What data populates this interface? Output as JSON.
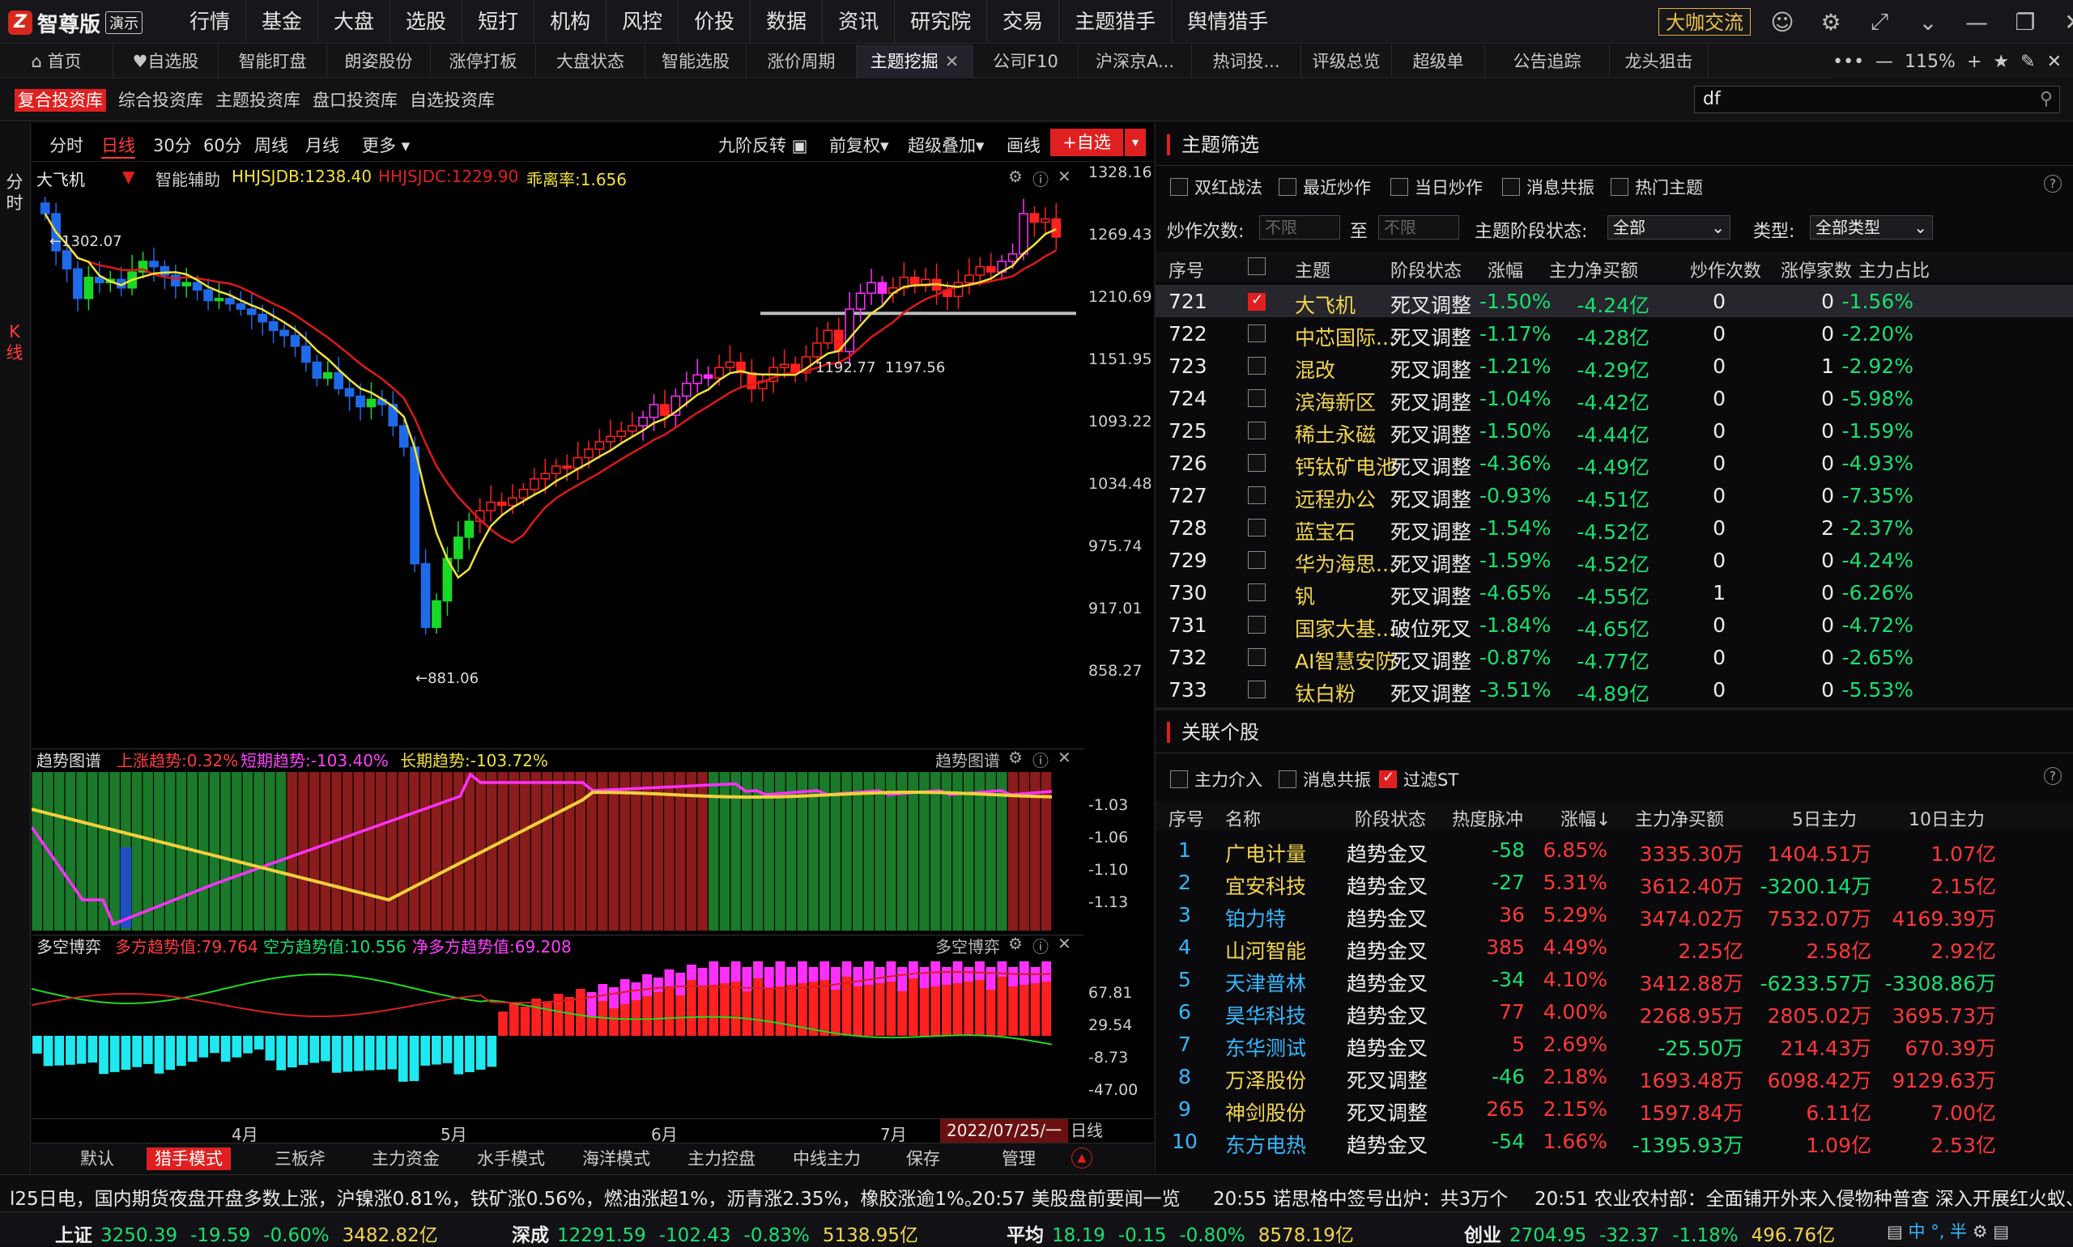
{
  "app": {
    "logo_mark": "Z",
    "title": "智尊版",
    "badge": "演示"
  },
  "top_menu": [
    "行情",
    "基金",
    "大盘",
    "选股",
    "短打",
    "机构",
    "风控",
    "价投",
    "数据",
    "资讯",
    "研究院",
    "交易",
    "主题猎手",
    "舆情猎手"
  ],
  "dakai": "大咖交流",
  "tabs": [
    "首页",
    "自选股",
    "智能盯盘",
    "朗姿股份",
    "涨停打板",
    "大盘状态",
    "智能选股",
    "涨价周期",
    "主题挖掘",
    "公司F10",
    "沪深京A...",
    "热词投...",
    "评级总览",
    "超级单",
    "公告追踪",
    "龙头狙击"
  ],
  "active_tab": "主题挖掘",
  "zoom": "115%",
  "sub_tabs": [
    "复合投资库",
    "综合投资库",
    "主题投资库",
    "盘口投资库",
    "自选投资库"
  ],
  "search_value": "df",
  "left_strip": {
    "top": "分时",
    "bottom": "K线"
  },
  "periods": [
    "分时",
    "日线",
    "30分",
    "60分",
    "周线",
    "月线",
    "更多"
  ],
  "active_period": "日线",
  "chart_toolbar": {
    "jiujie": "九阶反转",
    "fuquan": "前复权",
    "diejia": "超级叠加",
    "huaxian": "画线",
    "add": "+自选"
  },
  "indicator_main": {
    "name": "大飞机",
    "assist": "智能辅助",
    "hhjsjdb": "HHJSJDB:1238.40",
    "hhjsjdc": "HHJSJDC:1229.90",
    "guaili": "乖离率:1.656"
  },
  "indicator_trend": {
    "name": "趋势图谱",
    "up": "上涨趋势:0.32%",
    "short": "短期趋势:-103.40%",
    "long": "长期趋势:-103.72%"
  },
  "indicator_duokong": {
    "name": "多空博弈",
    "duo": "多方趋势值:79.764",
    "kong": "空方趋势值:10.556",
    "jing": "净多方趋势值:69.208"
  },
  "price_labels": {
    "high": "1302.07",
    "low": "881.06",
    "mid1": "1192.77",
    "mid2": "1197.56"
  },
  "chart_data": [
    {
      "type": "candlestick",
      "title": "大飞机",
      "yaxis_ticks": [
        "1328.16",
        "1269.43",
        "1210.69",
        "1151.95",
        "1093.22",
        "1034.48",
        "975.74",
        "917.01",
        "858.27"
      ],
      "xaxis_ticks": [
        "4月",
        "5月",
        "6月",
        "7月"
      ],
      "cursor_date": "2022/07/25/一",
      "period": "日线",
      "high_marker": 1302.07,
      "low_marker": 881.06,
      "support_line": [
        1192.77,
        1197.56
      ],
      "close_series": [
        1290,
        1255,
        1238,
        1210,
        1230,
        1225,
        1228,
        1220,
        1235,
        1245,
        1240,
        1232,
        1222,
        1225,
        1218,
        1208,
        1210,
        1205,
        1200,
        1195,
        1188,
        1180,
        1175,
        1165,
        1150,
        1135,
        1140,
        1125,
        1118,
        1108,
        1115,
        1110,
        1090,
        1070,
        960,
        900,
        925,
        965,
        985,
        1000,
        1010,
        1018,
        1015,
        1022,
        1030,
        1040,
        1045,
        1052,
        1050,
        1060,
        1068,
        1075,
        1080,
        1085,
        1090,
        1098,
        1110,
        1100,
        1118,
        1130,
        1138,
        1135,
        1145,
        1150,
        1140,
        1125,
        1132,
        1145,
        1148,
        1140,
        1155,
        1168,
        1180,
        1160,
        1200,
        1215,
        1225,
        1215,
        1220,
        1230,
        1222,
        1228,
        1218,
        1212,
        1225,
        1232,
        1240,
        1235,
        1245,
        1252,
        1290,
        1282,
        1285,
        1268
      ],
      "ma_fast_yellow_end": 1238.4,
      "ma_slow_red_end": 1229.9
    },
    {
      "type": "bar",
      "title": "趋势图谱",
      "yaxis_ticks": [
        "-1.03",
        "-1.06",
        "-1.10",
        "-1.13"
      ],
      "note_series": [
        "上涨趋势",
        "短期趋势",
        "长期趋势"
      ]
    },
    {
      "type": "bar",
      "title": "多空博弈",
      "yaxis_ticks": [
        "67.81",
        "29.54",
        "-8.73",
        "-47.00"
      ],
      "series": [
        {
          "name": "多方趋势值",
          "last": 79.764
        },
        {
          "name": "空方趋势值",
          "last": 10.556
        },
        {
          "name": "净多方趋势值",
          "last": 69.208
        }
      ]
    }
  ],
  "bottom_tabs": [
    "默认",
    "猎手模式",
    "三板斧",
    "主力资金",
    "水手模式",
    "海洋模式",
    "主力控盘",
    "中线主力",
    "保存",
    "管理"
  ],
  "active_bottom_tab": "猎手模式",
  "theme_filter": {
    "title": "主题筛选",
    "checks": [
      {
        "label": "双红战法",
        "on": false
      },
      {
        "label": "最近炒作",
        "on": false
      },
      {
        "label": "当日炒作",
        "on": false
      },
      {
        "label": "消息共振",
        "on": false
      },
      {
        "label": "热门主题",
        "on": false
      }
    ],
    "chaozuo_label": "炒作次数:",
    "placeholder_min": "不限",
    "to": "至",
    "placeholder_max": "不限",
    "stage_label": "主题阶段状态:",
    "stage_value": "全部",
    "type_label": "类型:",
    "type_value": "全部类型",
    "columns": [
      "序号",
      "主题",
      "阶段状态",
      "涨幅",
      "主力净买额",
      "炒作次数",
      "涨停家数",
      "主力占比"
    ],
    "rows": [
      {
        "no": "721",
        "name": "大飞机",
        "stage": "死叉调整",
        "chg": "-1.50%",
        "net": "-4.24亿",
        "times": "0",
        "zt": "0",
        "ratio": "-1.56%",
        "checked": true
      },
      {
        "no": "722",
        "name": "中芯国际...",
        "stage": "死叉调整",
        "chg": "-1.17%",
        "net": "-4.28亿",
        "times": "0",
        "zt": "0",
        "ratio": "-2.20%",
        "checked": false
      },
      {
        "no": "723",
        "name": "混改",
        "stage": "死叉调整",
        "chg": "-1.21%",
        "net": "-4.29亿",
        "times": "0",
        "zt": "1",
        "ratio": "-2.92%",
        "checked": false
      },
      {
        "no": "724",
        "name": "滨海新区",
        "stage": "死叉调整",
        "chg": "-1.04%",
        "net": "-4.42亿",
        "times": "0",
        "zt": "0",
        "ratio": "-5.98%",
        "checked": false
      },
      {
        "no": "725",
        "name": "稀土永磁",
        "stage": "死叉调整",
        "chg": "-1.50%",
        "net": "-4.44亿",
        "times": "0",
        "zt": "0",
        "ratio": "-1.59%",
        "checked": false
      },
      {
        "no": "726",
        "name": "钙钛矿电池",
        "stage": "死叉调整",
        "chg": "-4.36%",
        "net": "-4.49亿",
        "times": "0",
        "zt": "0",
        "ratio": "-4.93%",
        "checked": false
      },
      {
        "no": "727",
        "name": "远程办公",
        "stage": "死叉调整",
        "chg": "-0.93%",
        "net": "-4.51亿",
        "times": "0",
        "zt": "0",
        "ratio": "-7.35%",
        "checked": false
      },
      {
        "no": "728",
        "name": "蓝宝石",
        "stage": "死叉调整",
        "chg": "-1.54%",
        "net": "-4.52亿",
        "times": "0",
        "zt": "2",
        "ratio": "-2.37%",
        "checked": false
      },
      {
        "no": "729",
        "name": "华为海思...",
        "stage": "死叉调整",
        "chg": "-1.59%",
        "net": "-4.52亿",
        "times": "0",
        "zt": "0",
        "ratio": "-4.24%",
        "checked": false
      },
      {
        "no": "730",
        "name": "钒",
        "stage": "死叉调整",
        "chg": "-4.65%",
        "net": "-4.55亿",
        "times": "1",
        "zt": "0",
        "ratio": "-6.26%",
        "checked": false
      },
      {
        "no": "731",
        "name": "国家大基...",
        "stage": "破位死叉",
        "chg": "-1.84%",
        "net": "-4.65亿",
        "times": "0",
        "zt": "0",
        "ratio": "-4.72%",
        "checked": false
      },
      {
        "no": "732",
        "name": "AI智慧安防",
        "stage": "死叉调整",
        "chg": "-0.87%",
        "net": "-4.77亿",
        "times": "0",
        "zt": "0",
        "ratio": "-2.65%",
        "checked": false
      },
      {
        "no": "733",
        "name": "钛白粉",
        "stage": "死叉调整",
        "chg": "-3.51%",
        "net": "-4.89亿",
        "times": "0",
        "zt": "0",
        "ratio": "-5.53%",
        "checked": false
      }
    ]
  },
  "related": {
    "title": "关联个股",
    "checks": [
      {
        "label": "主力介入",
        "on": false
      },
      {
        "label": "消息共振",
        "on": false
      },
      {
        "label": "过滤ST",
        "on": true
      }
    ],
    "columns": [
      "序号",
      "名称",
      "阶段状态",
      "热度脉冲",
      "涨幅↓",
      "主力净买额",
      "5日主力",
      "10日主力"
    ],
    "rows": [
      {
        "no": "1",
        "name": "广电计量",
        "nc": "yel",
        "stage": "趋势金叉",
        "heat": "-58",
        "chg": "6.85%",
        "net": "3335.30万",
        "d5": "1404.51万",
        "d10": "1.07亿"
      },
      {
        "no": "2",
        "name": "宜安科技",
        "nc": "yel",
        "stage": "趋势金叉",
        "heat": "-27",
        "chg": "5.31%",
        "net": "3612.40万",
        "d5": "-3200.14万",
        "d10": "2.15亿"
      },
      {
        "no": "3",
        "name": "铂力特",
        "nc": "cyan",
        "stage": "趋势金叉",
        "heat": "36",
        "chg": "5.29%",
        "net": "3474.02万",
        "d5": "7532.07万",
        "d10": "4169.39万"
      },
      {
        "no": "4",
        "name": "山河智能",
        "nc": "yel",
        "stage": "趋势金叉",
        "heat": "385",
        "chg": "4.49%",
        "net": "2.25亿",
        "d5": "2.58亿",
        "d10": "2.92亿"
      },
      {
        "no": "5",
        "name": "天津普林",
        "nc": "cyan",
        "stage": "趋势金叉",
        "heat": "-34",
        "chg": "4.10%",
        "net": "3412.88万",
        "d5": "-6233.57万",
        "d10": "-3308.86万"
      },
      {
        "no": "6",
        "name": "昊华科技",
        "nc": "cyan",
        "stage": "趋势金叉",
        "heat": "77",
        "chg": "4.00%",
        "net": "2268.95万",
        "d5": "2805.02万",
        "d10": "3695.73万"
      },
      {
        "no": "7",
        "name": "东华测试",
        "nc": "cyan",
        "stage": "趋势金叉",
        "heat": "5",
        "chg": "2.69%",
        "net": "-25.50万",
        "d5": "214.43万",
        "d10": "670.39万"
      },
      {
        "no": "8",
        "name": "万泽股份",
        "nc": "yel",
        "stage": "死叉调整",
        "heat": "-46",
        "chg": "2.18%",
        "net": "1693.48万",
        "d5": "6098.42万",
        "d10": "9129.63万"
      },
      {
        "no": "9",
        "name": "神剑股份",
        "nc": "yel",
        "stage": "死叉调整",
        "heat": "265",
        "chg": "2.15%",
        "net": "1597.84万",
        "d5": "6.11亿",
        "d10": "7.00亿"
      },
      {
        "no": "10",
        "name": "东方电热",
        "nc": "cyan",
        "stage": "趋势金叉",
        "heat": "-54",
        "chg": "1.66%",
        "net": "-1395.93万",
        "d5": "1.09亿",
        "d10": "2.53亿"
      }
    ]
  },
  "news": [
    "l25日电，国内期货夜盘开盘多数上涨，沪镍涨0.81%，铁矿涨0.56%，燃油涨超1%，沥青涨2.35%，橡胶涨逾1%。",
    "20:57 美股盘前要闻一览",
    "20:55 诺思格中签号出炉：共3万个",
    "20:51 农业农村部：全面铺开外来入侵物种普查 深入开展红火蚁、"
  ],
  "indices": [
    {
      "name": "上证",
      "price": "3250.39",
      "chg": "-19.59",
      "pct": "-0.60%",
      "amt": "3482.82亿"
    },
    {
      "name": "深成",
      "price": "12291.59",
      "chg": "-102.43",
      "pct": "-0.83%",
      "amt": "5138.95亿"
    },
    {
      "name": "平均",
      "price": "18.19",
      "chg": "-0.15",
      "pct": "-0.80%",
      "amt": "8578.19亿"
    },
    {
      "name": "创业",
      "price": "2704.95",
      "chg": "-32.37",
      "pct": "-1.18%",
      "amt": "496.76亿"
    }
  ],
  "ime": "中 °, 半",
  "colors": {
    "up": "#ff2020",
    "down": "#18d828",
    "accent": "#e02020",
    "ma_yellow": "#f2e23a",
    "ma_red": "#e01818",
    "magenta": "#ff30ff",
    "cyan": "#20e8f0"
  }
}
